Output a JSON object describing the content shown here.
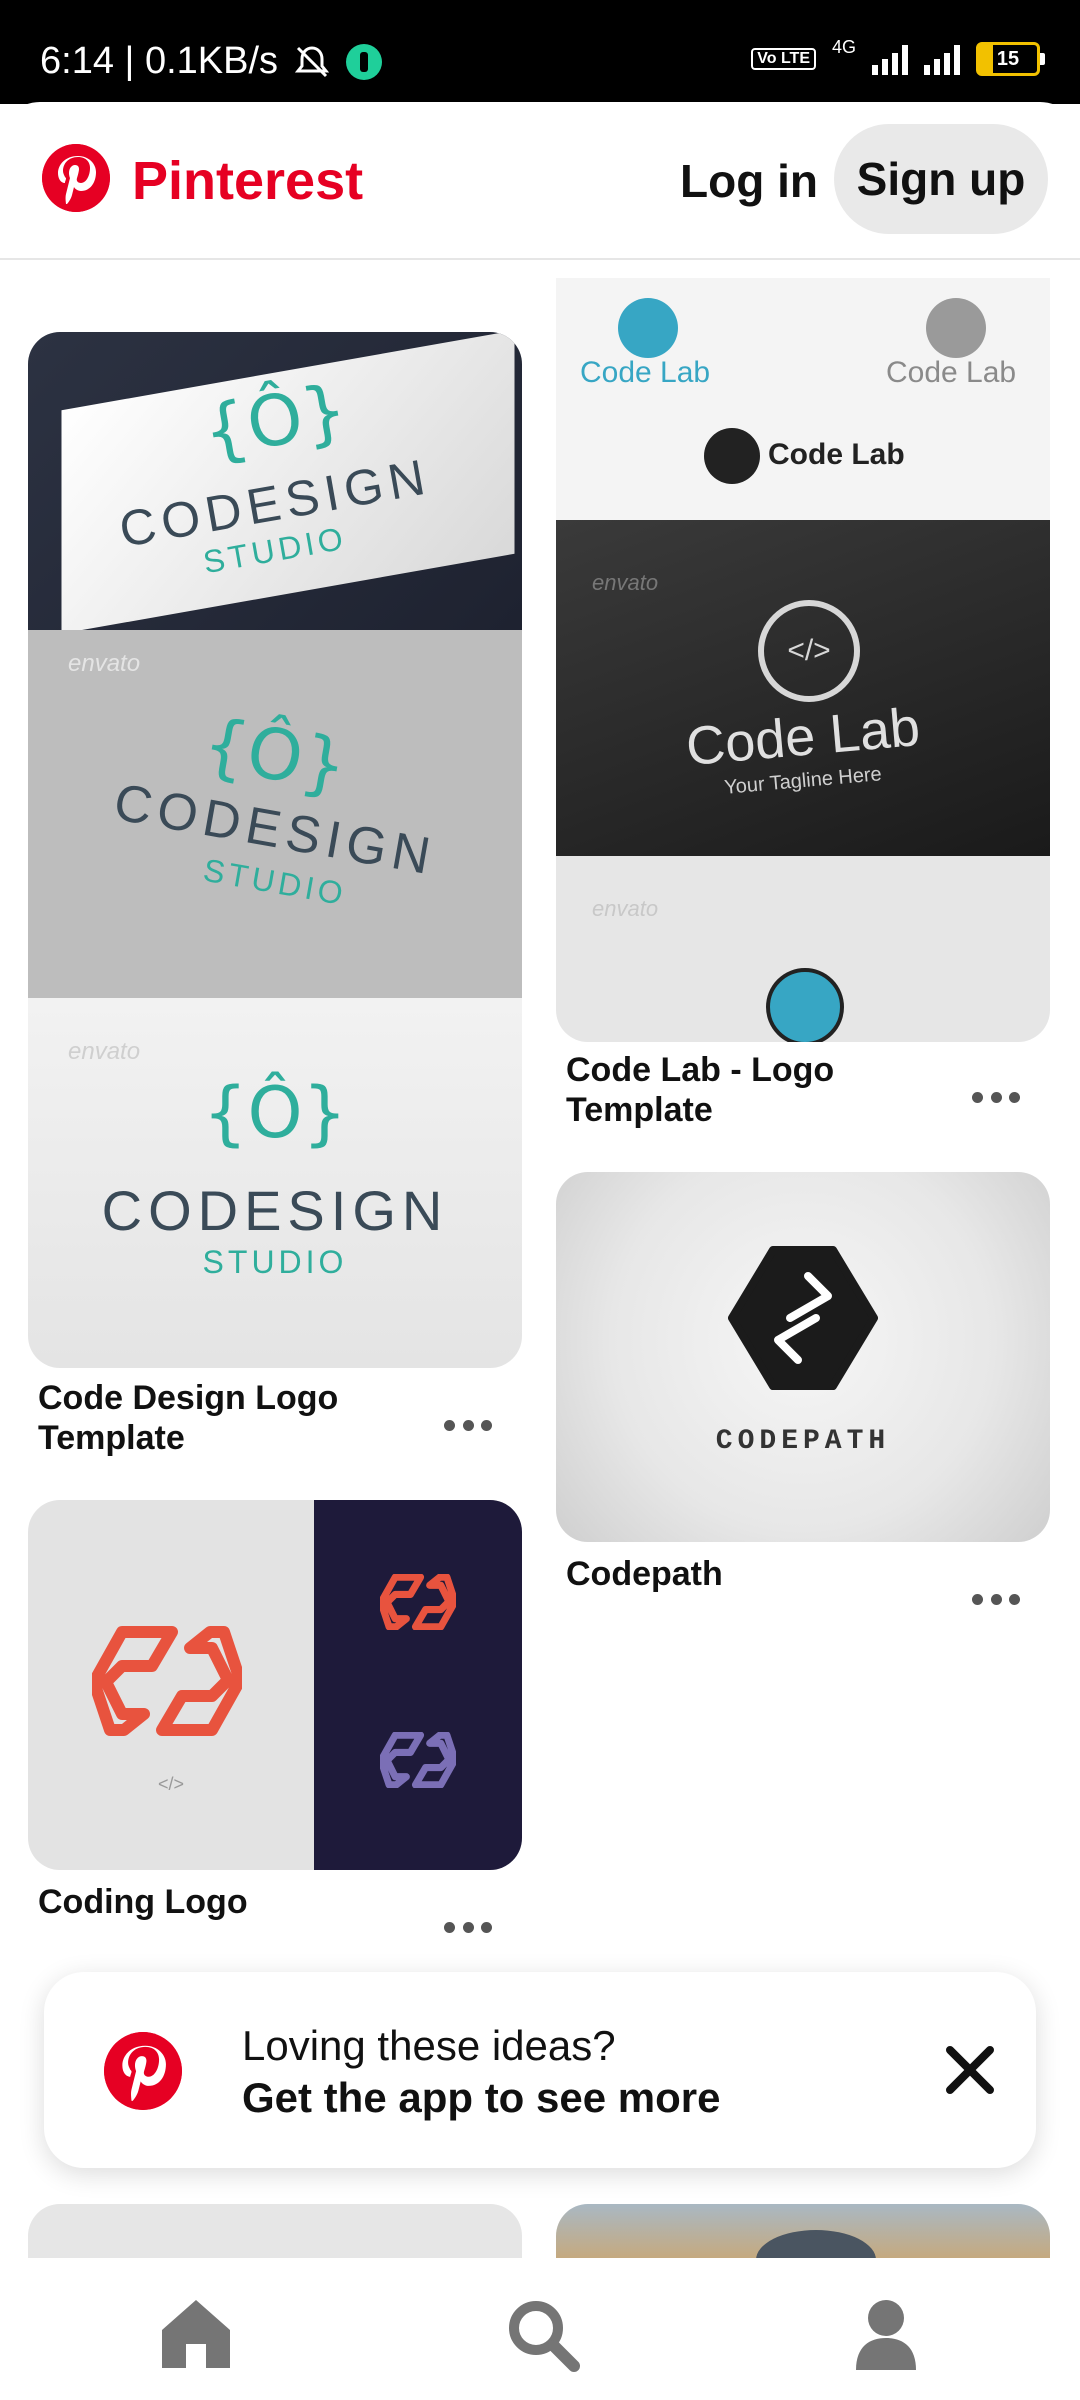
{
  "status_bar": {
    "time_speed": "6:14 | 0.1KB/s",
    "network": "4G",
    "volte": "Vo LTE",
    "battery": "15"
  },
  "header": {
    "brand": "Pinterest",
    "login_label": "Log in",
    "signup_label": "Sign up"
  },
  "pins": [
    {
      "title": "Code Design Logo Template",
      "image": {
        "logo_word": "CODESIGN",
        "logo_sub": "STUDIO",
        "watermark": "envato"
      }
    },
    {
      "title": "Code Lab - Logo Template",
      "image": {
        "logo_word": "Code Lab",
        "tagline": "Your Tagline Here",
        "watermark": "envato"
      }
    },
    {
      "title": "Codepath",
      "image": {
        "logo_word": "CODEPATH"
      }
    },
    {
      "title": "Coding Logo",
      "image": {
        "caption": "</>"
      }
    }
  ],
  "banner": {
    "line1": "Loving these ideas?",
    "line2": "Get the app to see more"
  },
  "bottom_nav": {
    "items": [
      "home-icon",
      "search-icon",
      "profile-icon"
    ]
  },
  "colors": {
    "brand": "#e60023",
    "teal": "#2fae9c",
    "coding_red": "#e8533e",
    "navy": "#1e1a3a"
  }
}
